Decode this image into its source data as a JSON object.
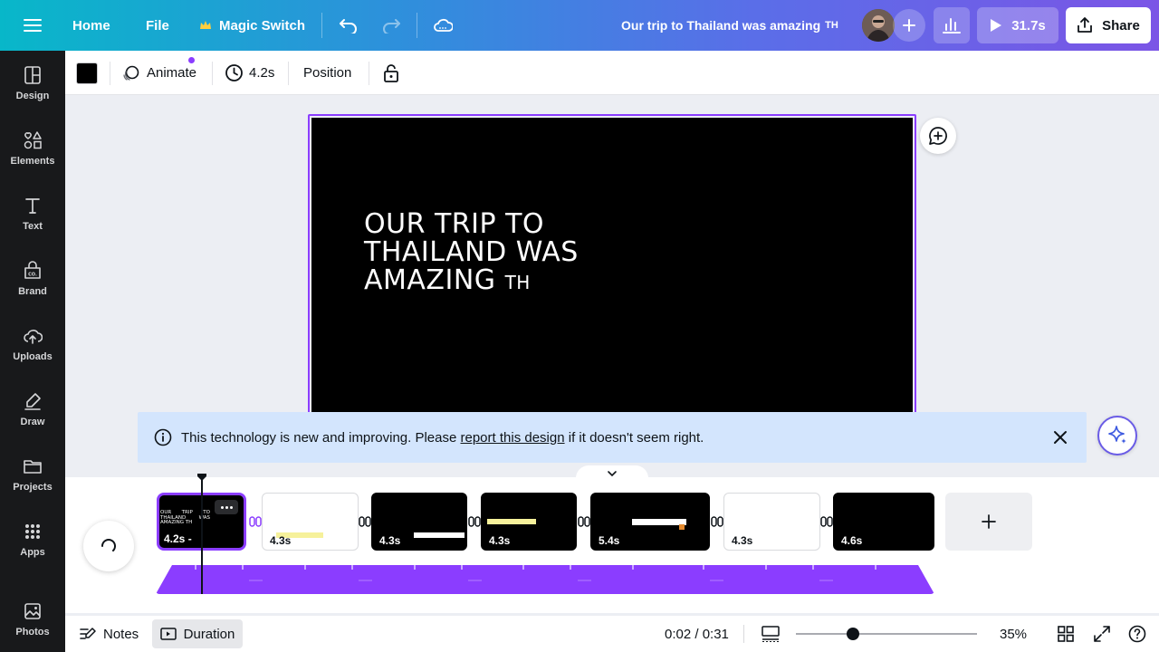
{
  "topbar": {
    "menu_icon": "hamburger-icon",
    "home": "Home",
    "file": "File",
    "magic_switch": "Magic Switch",
    "doc_title": "Our trip to Thailand was amazing",
    "doc_title_suffix": "TH",
    "play_duration": "31.7s",
    "share": "Share"
  },
  "sidebar": {
    "items": [
      {
        "label": "Design",
        "icon": "layout-icon"
      },
      {
        "label": "Elements",
        "icon": "shapes-icon"
      },
      {
        "label": "Text",
        "icon": "text-icon"
      },
      {
        "label": "Brand",
        "icon": "brand-icon"
      },
      {
        "label": "Uploads",
        "icon": "cloud-upload-icon"
      },
      {
        "label": "Draw",
        "icon": "pen-icon"
      },
      {
        "label": "Projects",
        "icon": "folder-icon"
      },
      {
        "label": "Apps",
        "icon": "apps-grid-icon"
      },
      {
        "label": "Photos",
        "icon": "image-icon"
      }
    ]
  },
  "toolbar": {
    "color_swatch": "#000000",
    "animate": "Animate",
    "duration": "4.2s",
    "position": "Position"
  },
  "canvas": {
    "line1": "OUR TRIP TO",
    "line2": "THAILAND WAS",
    "line3": "AMAZING",
    "line3_suffix": "TH"
  },
  "notice": {
    "text_before": "This technology is new and improving. Please ",
    "link": "report this design",
    "text_after": " if it doesn't seem right."
  },
  "timeline": {
    "clips": [
      {
        "duration": "4.2s",
        "theme": "dark",
        "selected": true
      },
      {
        "duration": "4.3s",
        "theme": "light",
        "selected": false
      },
      {
        "duration": "4.3s",
        "theme": "dark",
        "selected": false
      },
      {
        "duration": "4.3s",
        "theme": "dark",
        "selected": false
      },
      {
        "duration": "5.4s",
        "theme": "dark",
        "selected": false
      },
      {
        "duration": "4.3s",
        "theme": "light",
        "selected": false
      },
      {
        "duration": "4.6s",
        "theme": "dark",
        "selected": false
      }
    ],
    "thumb1": {
      "l1": "OUR",
      "l1b": "TRIP",
      "l1c": "TO",
      "l2": "THAILAND",
      "l2b": "WAS",
      "l3": "AMAZING TH"
    }
  },
  "bottombar": {
    "notes": "Notes",
    "duration": "Duration",
    "time": "0:02 / 0:31",
    "zoom": "35%",
    "zoom_level": 0.35
  },
  "colors": {
    "accent": "#8b3dff",
    "notice_bg": "#d3e5fd",
    "sidebar_bg": "#18191b"
  }
}
